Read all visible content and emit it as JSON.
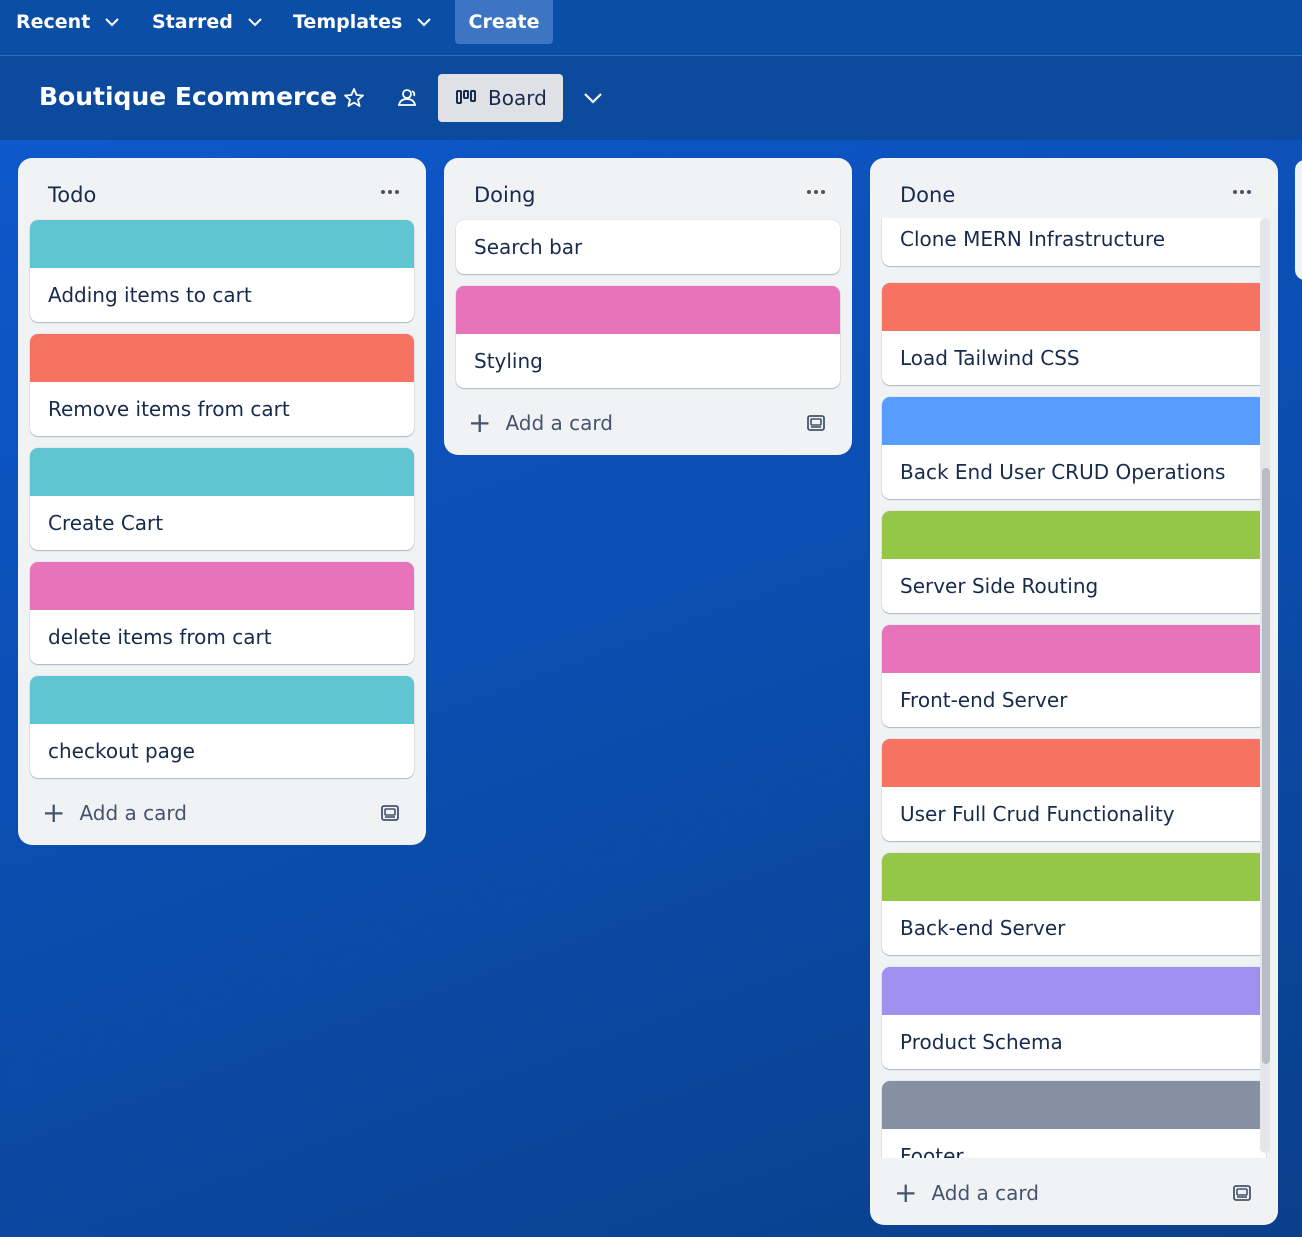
{
  "nav": {
    "recent": "Recent",
    "starred": "Starred",
    "templates": "Templates",
    "create": "Create"
  },
  "board": {
    "title": "Boutique Ecommerce",
    "view_label": "Board"
  },
  "colors": {
    "teal": "#5fc6d1",
    "salmon": "#f67361",
    "pink": "#e774bb",
    "blue": "#579dff",
    "green": "#94c748",
    "purple": "#9f8fef",
    "gray": "#8590a2"
  },
  "lists": [
    {
      "title": "Todo",
      "add_card": "Add a card",
      "cards": [
        {
          "text": "Adding items to cart",
          "cover": "teal"
        },
        {
          "text": "Remove items from cart",
          "cover": "salmon"
        },
        {
          "text": "Create Cart",
          "cover": "teal"
        },
        {
          "text": "delete items from cart",
          "cover": "pink"
        },
        {
          "text": "checkout page",
          "cover": "teal"
        }
      ]
    },
    {
      "title": "Doing",
      "add_card": "Add a card",
      "cards": [
        {
          "text": "Search bar",
          "cover": null
        },
        {
          "text": "Styling",
          "cover": "pink"
        }
      ]
    },
    {
      "title": "Done",
      "add_card": "Add a card",
      "cards": [
        {
          "text": "Clone MERN Infrastructure",
          "cover": null
        },
        {
          "text": "Load Tailwind CSS",
          "cover": "salmon"
        },
        {
          "text": "Back End User CRUD Operations",
          "cover": "blue"
        },
        {
          "text": "Server Side Routing",
          "cover": "green"
        },
        {
          "text": "Front-end Server",
          "cover": "pink"
        },
        {
          "text": "User Full Crud Functionality",
          "cover": "salmon"
        },
        {
          "text": "Back-end Server",
          "cover": "green"
        },
        {
          "text": "Product Schema",
          "cover": "purple"
        },
        {
          "text": "Footer",
          "cover": "gray"
        }
      ]
    }
  ]
}
